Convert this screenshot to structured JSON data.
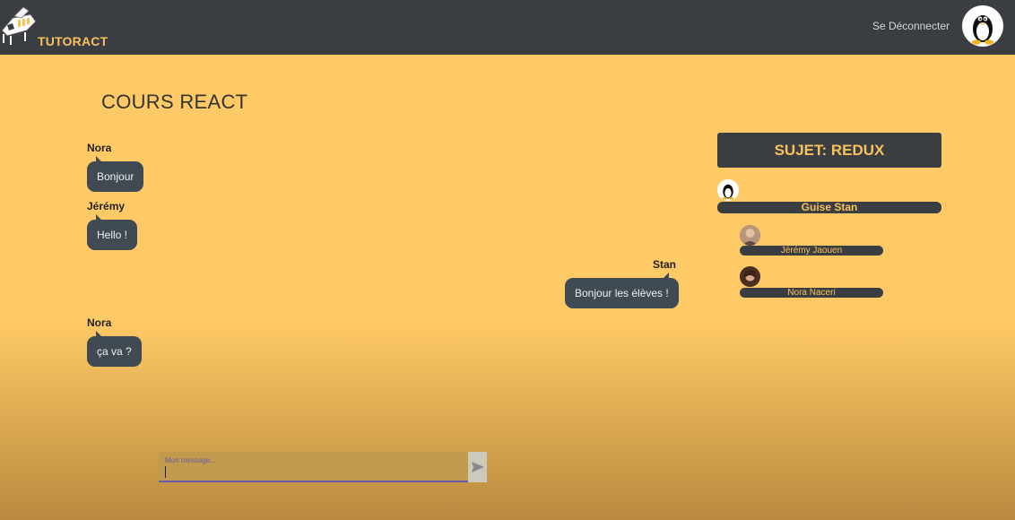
{
  "header": {
    "brand": "TUTORACT",
    "logout_label": "Se Déconnecter"
  },
  "page_title": "COURS REACT",
  "messages": [
    {
      "author": "Nora",
      "text": "Bonjour",
      "side": "left"
    },
    {
      "author": "Jérémy",
      "text": "Hello !",
      "side": "left"
    },
    {
      "author": "Stan",
      "text": "Bonjour les élèves !",
      "side": "right"
    },
    {
      "author": "Nora",
      "text": "ça va ?",
      "side": "left"
    }
  ],
  "subject": "SUJET: REDUX",
  "members": [
    {
      "name": "Guise Stan",
      "role": "teacher"
    },
    {
      "name": "Jérémy Jaouen",
      "role": "student"
    },
    {
      "name": "Nora Naceri",
      "role": "student"
    }
  ],
  "composer": {
    "label": "Mon message...",
    "value": ""
  },
  "colors": {
    "accent": "#f7c25b",
    "dark": "#3a3d42",
    "background": "#ffc965",
    "bubble": "#3f4a52",
    "input_underline": "#6a5ca8"
  },
  "icons": {
    "logo": "piano-logo-icon",
    "user_avatar": "penguin-avatar-icon",
    "send": "send-arrow-icon"
  }
}
